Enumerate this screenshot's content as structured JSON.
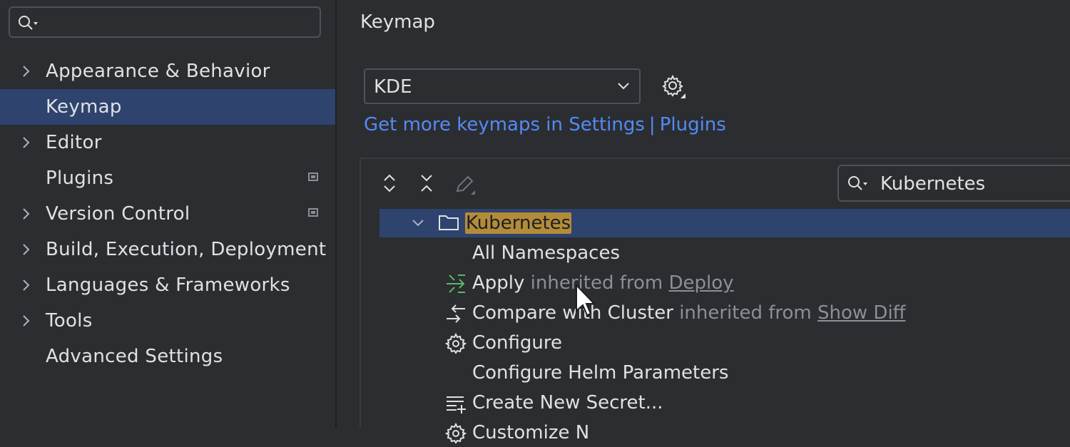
{
  "sidebar": {
    "search": {
      "value": ""
    },
    "items": [
      {
        "label": "Appearance & Behavior",
        "expandable": true,
        "selected": false,
        "badge": false
      },
      {
        "label": "Keymap",
        "expandable": false,
        "selected": true,
        "badge": false
      },
      {
        "label": "Editor",
        "expandable": true,
        "selected": false,
        "badge": false
      },
      {
        "label": "Plugins",
        "expandable": false,
        "selected": false,
        "badge": true
      },
      {
        "label": "Version Control",
        "expandable": true,
        "selected": false,
        "badge": true
      },
      {
        "label": "Build, Execution, Deployment",
        "expandable": true,
        "selected": false,
        "badge": false
      },
      {
        "label": "Languages & Frameworks",
        "expandable": true,
        "selected": false,
        "badge": false
      },
      {
        "label": "Tools",
        "expandable": true,
        "selected": false,
        "badge": false
      },
      {
        "label": "Advanced Settings",
        "expandable": false,
        "selected": false,
        "badge": false
      }
    ]
  },
  "main": {
    "title": "Keymap",
    "keymap_select": {
      "value": "KDE"
    },
    "links": {
      "part1": "Get more keymaps in Settings",
      "separator": "|",
      "part2": "Plugins"
    },
    "filter": {
      "value": "Kubernetes"
    },
    "tree": {
      "group": {
        "label": "Kubernetes",
        "expanded": true,
        "icon": "folder-icon"
      },
      "rows": [
        {
          "label": "All Namespaces",
          "suffix": "",
          "inherited": "",
          "icon": ""
        },
        {
          "label": "Apply",
          "suffix": "inherited from",
          "inherited": "Deploy",
          "icon": "apply-icon"
        },
        {
          "label": "Compare with Cluster",
          "suffix": "inherited from",
          "inherited": "Show Diff",
          "icon": "compare-icon"
        },
        {
          "label": "Configure",
          "suffix": "",
          "inherited": "",
          "icon": "gear-icon"
        },
        {
          "label": "Configure Helm Parameters",
          "suffix": "",
          "inherited": "",
          "icon": ""
        },
        {
          "label": "Create New Secret...",
          "suffix": "",
          "inherited": "",
          "icon": "list-add-icon"
        },
        {
          "label": "Customize N",
          "suffix": "",
          "inherited": "",
          "icon": "gear-icon"
        }
      ]
    }
  },
  "colors": {
    "background": "#2b2d30",
    "selection": "#2e436e",
    "link": "#548af7",
    "highlight": "#b38c3a",
    "muted": "#8c8f94",
    "apply_icon": "#5fb865"
  }
}
